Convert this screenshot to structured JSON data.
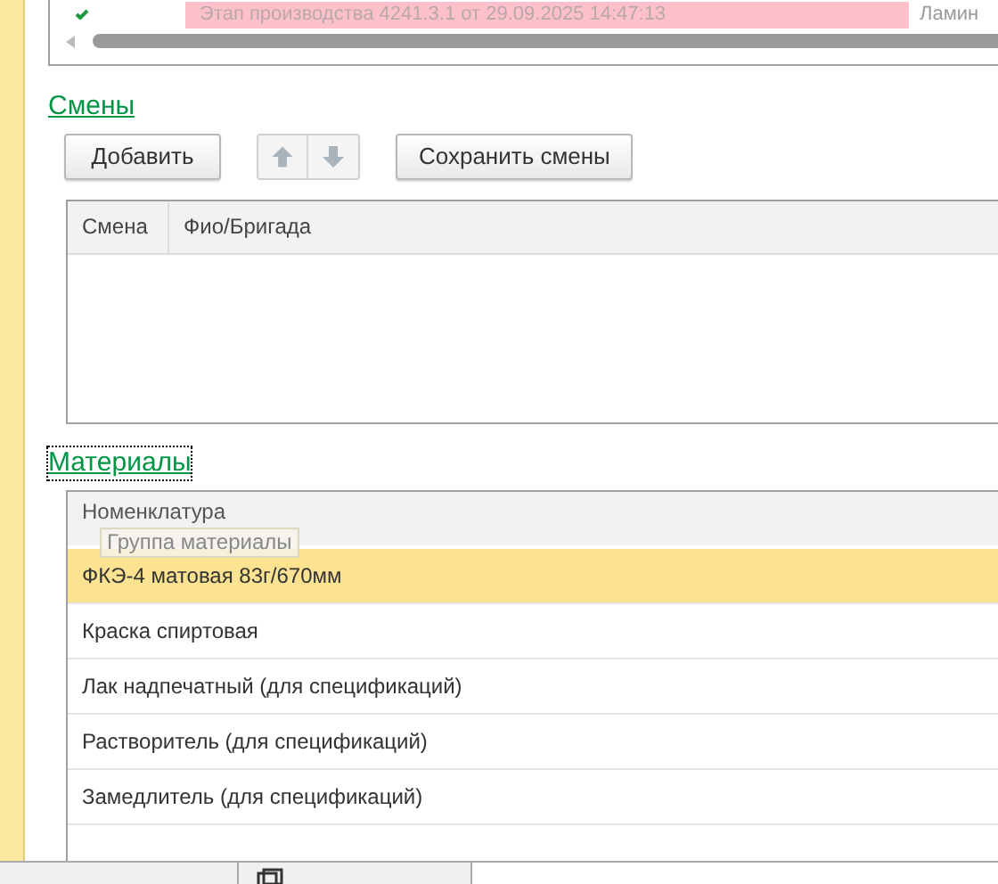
{
  "top_table": {
    "row_text": "Этап производства 4241.3.1 от 29.09.2025 14:47:13",
    "row_text_2": "Ламин"
  },
  "shifts": {
    "title": "Смены",
    "buttons": [
      "Добавить",
      "Сохранить смены"
    ],
    "columns": [
      "Смена",
      "Фио/Бригада"
    ]
  },
  "materials": {
    "title": "Материалы",
    "columns": [
      "Номенклатура"
    ],
    "tooltip": "Группа материалы",
    "rows": [
      {
        "name": "ФКЭ-4 матовая 83г/670мм",
        "selected": true
      },
      {
        "name": "Краска спиртовая",
        "selected": false
      },
      {
        "name": "Лак надпечатный (для спецификаций)",
        "selected": false
      },
      {
        "name": "Растворитель (для спецификаций)",
        "selected": false
      },
      {
        "name": "Замедлитель (для спецификаций)",
        "selected": false
      }
    ]
  }
}
